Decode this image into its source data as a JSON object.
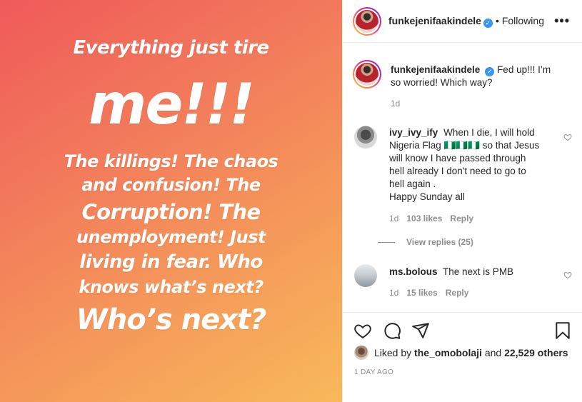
{
  "post": {
    "lines": [
      "Everything just tire",
      "me!!!",
      "The killings! The chaos",
      "and confusion! The",
      "Corruption! The",
      "unemployment! Just",
      "living in fear. Who",
      "knows what’s next?",
      "Who’s next?"
    ]
  },
  "header": {
    "username": "funkejenifaakindele",
    "separator": "•",
    "following_label": "Following",
    "more_icon": "•••"
  },
  "caption": {
    "username": "funkejenifaakindele",
    "text": "Fed up!!! I’m so worried! Which way?",
    "time": "1d"
  },
  "comments": [
    {
      "username": "ivy_ivy_ify",
      "text": "When I die, I will hold Nigeria Flag 🇳🇬🇳🇬🇳🇬 so that Jesus will know I have passed through hell already I don't need to go to hell again .",
      "text2": "Happy Sunday all",
      "time": "1d",
      "likes": "103 likes",
      "reply_label": "Reply",
      "view_replies": "View replies (25)"
    },
    {
      "username": "ms.bolous",
      "text": "The next is PMB",
      "time": "1d",
      "likes": "15 likes",
      "reply_label": "Reply"
    }
  ],
  "likes": {
    "prefix": "Liked by",
    "user": "the_omobolaji",
    "and": "and",
    "others": "22,529 others"
  },
  "time_ago": "1 DAY AGO",
  "icons": {
    "like": "heart-icon",
    "comment": "comment-icon",
    "share": "share-icon",
    "save": "bookmark-icon",
    "verified": "verified-badge-icon"
  },
  "colors": {
    "gradient_start": "#ef5a5a",
    "gradient_end": "#f8b95a",
    "verified": "#3897f0",
    "muted": "#8e8e8e"
  }
}
